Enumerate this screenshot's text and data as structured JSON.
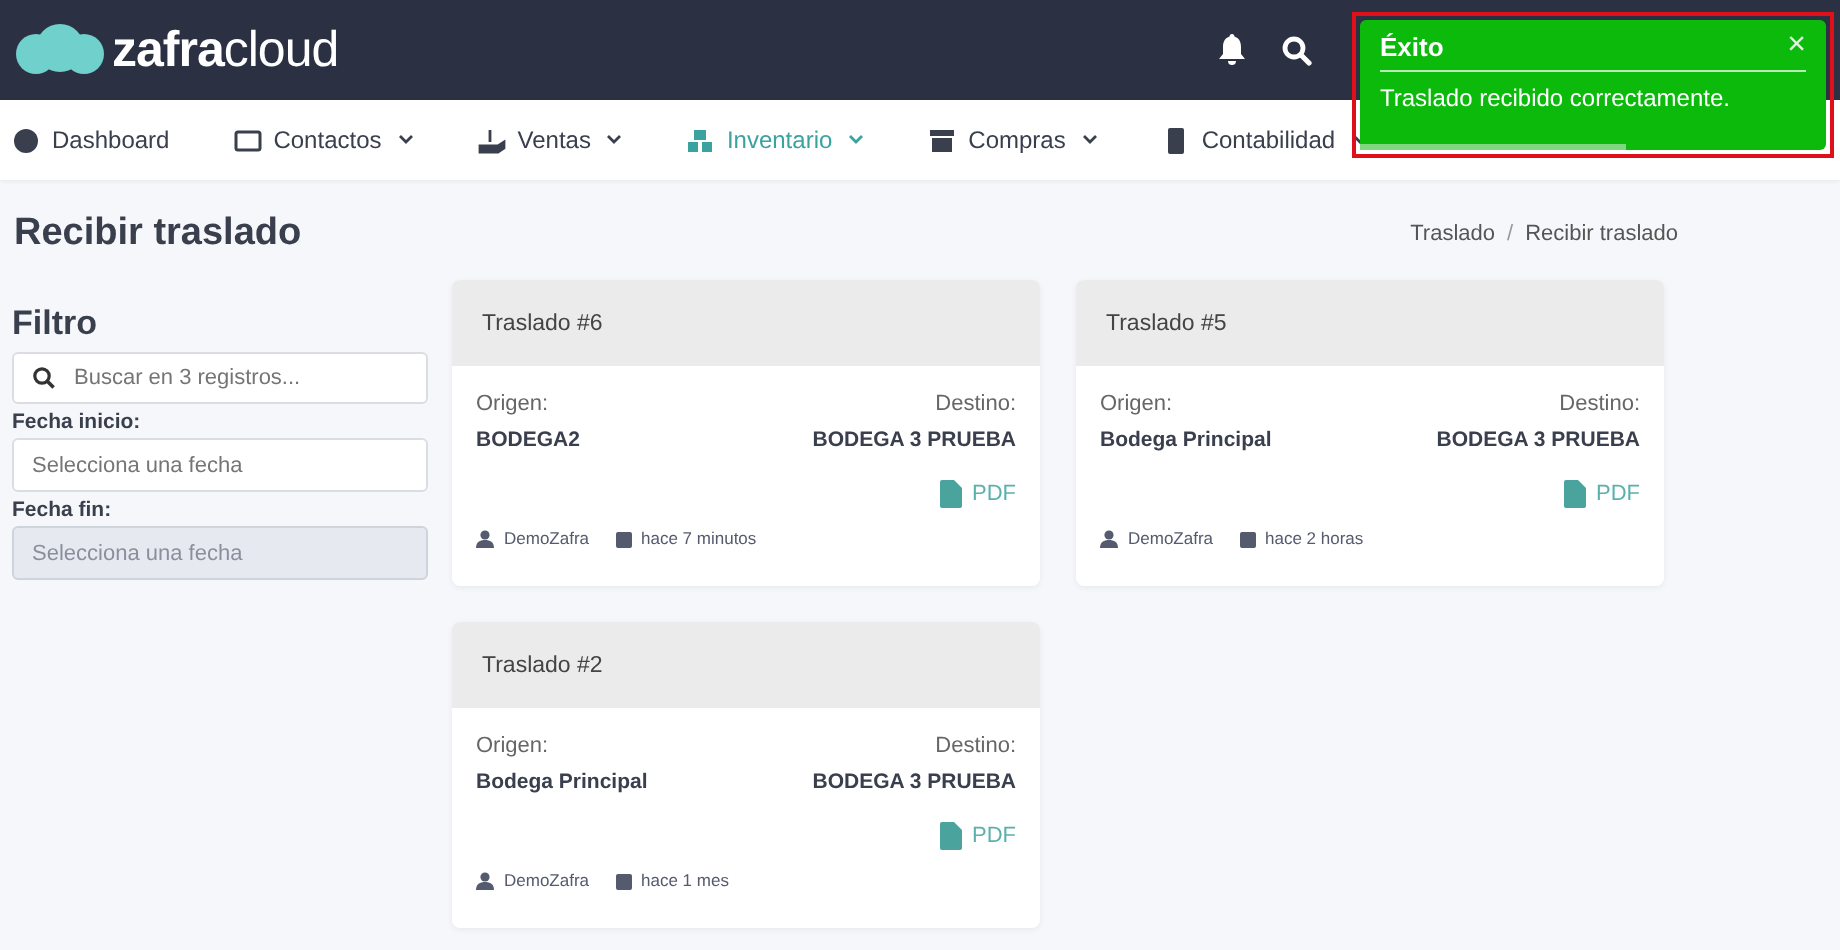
{
  "header": {
    "logo": "**zafra**cloud"
  },
  "nav": [
    {
      "label": "Dashboard",
      "dropdown": false,
      "selected": false
    },
    {
      "label": "Contactos",
      "dropdown": true,
      "selected": false
    },
    {
      "label": "Ventas",
      "dropdown": true,
      "selected": false
    },
    {
      "label": "Inventario",
      "dropdown": true,
      "selected": true
    },
    {
      "label": "Compras",
      "dropdown": true,
      "selected": false
    },
    {
      "label": "Contabilidad",
      "dropdown": true,
      "selected": false
    }
  ],
  "toast": {
    "title": "Éxito",
    "close": "×",
    "message": "Traslado recibido correctamente.",
    "level": 0.57
  },
  "page": {
    "title": "Recibir traslado",
    "breadcrumb": [
      "Traslado",
      "/",
      "Recibir traslado"
    ]
  },
  "filter": {
    "title": "Filtro",
    "search": {
      "placeholder": "Buscar en 3 registros..."
    },
    "fields": [
      {
        "label": "Fecha inicio:",
        "placeholder": "Selecciona una fecha",
        "disabled": false
      },
      {
        "label": "Fecha fin:",
        "placeholder": "Selecciona una fecha",
        "disabled": true
      }
    ]
  },
  "cards": [
    {
      "title": "Traslado #6",
      "origin_label": "Origen:",
      "origin": "BODEGA2",
      "dest_label": "Destino:",
      "dest": "BODEGA 3 PRUEBA",
      "pdf": "PDF",
      "user": "DemoZafra",
      "time": "hace 7 minutos"
    },
    {
      "title": "Traslado #5",
      "origin_label": "Origen:",
      "origin": "Bodega Principal",
      "dest_label": "Destino:",
      "dest": "BODEGA 3 PRUEBA",
      "pdf": "PDF",
      "user": "DemoZafra",
      "time": "hace 2 horas"
    },
    {
      "title": "Traslado #2",
      "origin_label": "Origen:",
      "origin": "Bodega Principal",
      "dest_label": "Destino:",
      "dest": "BODEGA 3 PRUEBA",
      "pdf": "PDF",
      "user": "DemoZafra",
      "time": "hace 1 mes"
    }
  ]
}
